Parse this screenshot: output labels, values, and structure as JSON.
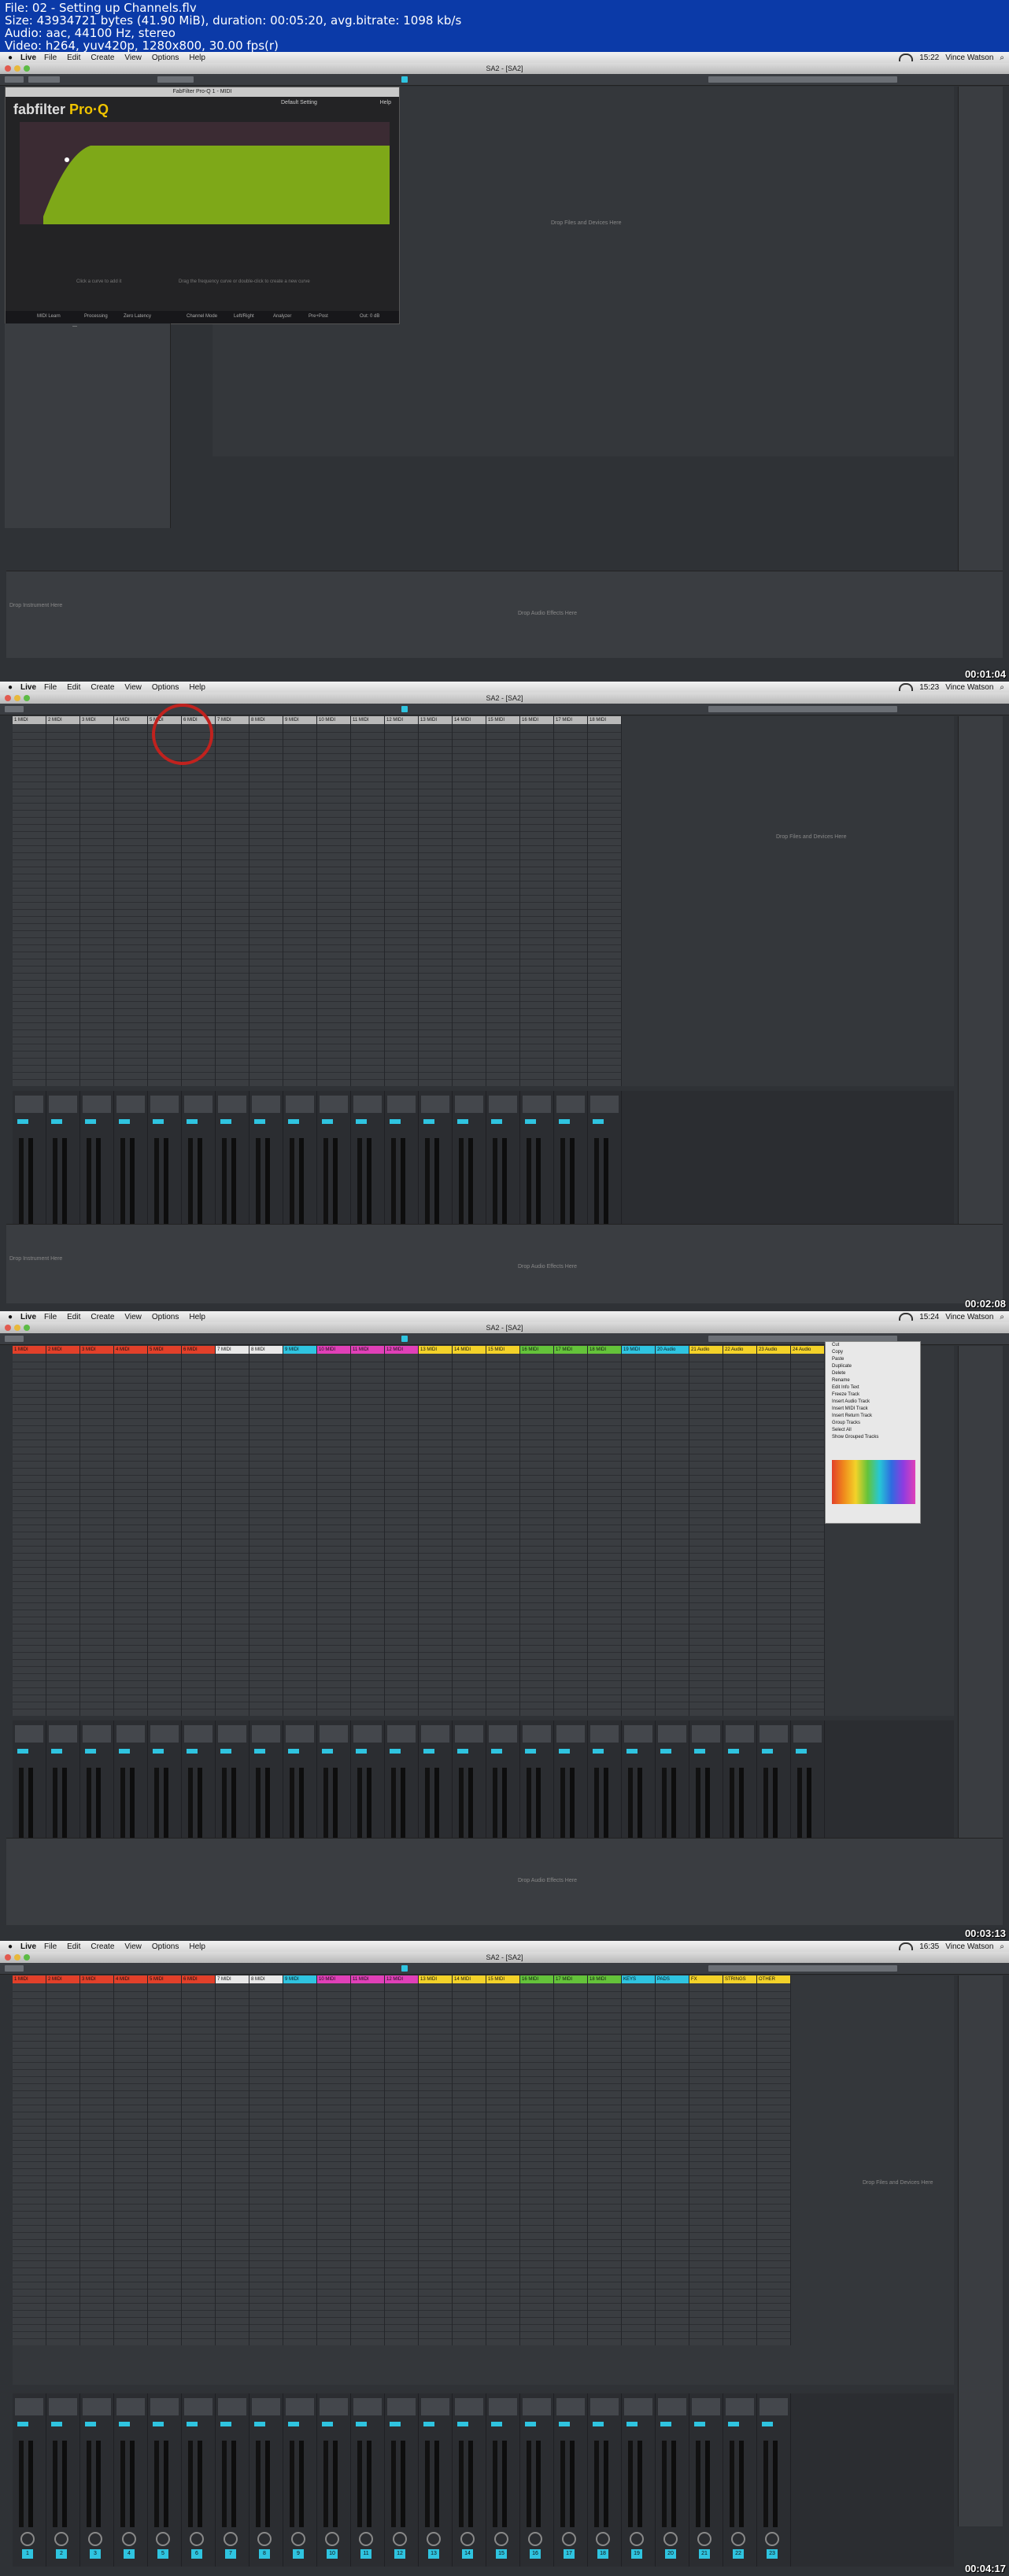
{
  "file_info": [
    "File: 02 - Setting up Channels.flv",
    "Size: 43934721 bytes (41.90 MiB), duration: 00:05:20, avg.bitrate: 1098 kb/s",
    "Audio: aac, 44100 Hz, stereo",
    "Video: h264, yuv420p, 1280x800, 30.00 fps(r)"
  ],
  "menubar": {
    "app": "Live",
    "items": [
      "File",
      "Edit",
      "Create",
      "View",
      "Options",
      "Help"
    ],
    "user": "Vince Watson"
  },
  "window_title": "SA2 - [SA2]",
  "frames": [
    {
      "timestamp": "00:01:04",
      "clock": "15:22"
    },
    {
      "timestamp": "00:02:08",
      "clock": "15:23"
    },
    {
      "timestamp": "00:03:13",
      "clock": "15:24"
    },
    {
      "timestamp": "00:04:17",
      "clock": "16:35"
    }
  ],
  "plugin": {
    "title": "FabFilter Pro-Q 1 - MIDI",
    "brand": "fabfilter",
    "product": "Pro·Q",
    "preset": "Default Setting",
    "help": "Help",
    "footer_items": [
      "MIDI Learn",
      "Processing",
      "Zero Latency",
      "Channel Mode",
      "Left/Right",
      "Analyzer",
      "Pre+Post",
      "Out: 0 dB"
    ],
    "hint_left": "Click a curve to add it",
    "hint_right": "Drag the frequency curve or double-click to create a new curve"
  },
  "hints": {
    "drop_files": "Drop Files and Devices Here",
    "drop_audio": "Drop Audio Effects Here",
    "drop_instrument": "Drop Instrument Here"
  },
  "frame2_tracks": [
    "1 MIDI",
    "2 MIDI",
    "3 MIDI",
    "4 MIDI",
    "5 MIDI",
    "6 MIDI",
    "7 MIDI",
    "8 MIDI",
    "9 MIDI",
    "10 MIDI",
    "11 MIDI",
    "12 MIDI",
    "13 MIDI",
    "14 MIDI",
    "15 MIDI",
    "16 MIDI",
    "17 MIDI",
    "18 MIDI"
  ],
  "frame3_tracks": [
    "1 MIDI",
    "2 MIDI",
    "3 MIDI",
    "4 MIDI",
    "5 MIDI",
    "6 MIDI",
    "7 MIDI",
    "8 MIDI",
    "9 MIDI",
    "10 MIDI",
    "11 MIDI",
    "12 MIDI",
    "13 MIDI",
    "14 MIDI",
    "15 MIDI",
    "16 MIDI",
    "17 MIDI",
    "18 MIDI",
    "19 MIDI",
    "20 Audio",
    "21 Audio",
    "22 Audio",
    "23 Audio",
    "24 Audio"
  ],
  "frame4_tracks": [
    "1 MIDI",
    "2 MIDI",
    "3 MIDI",
    "4 MIDI",
    "5 MIDI",
    "6 MIDI",
    "7 MIDI",
    "8 MIDI",
    "9 MIDI",
    "10 MIDI",
    "11 MIDI",
    "12 MIDI",
    "13 MIDI",
    "14 MIDI",
    "15 MIDI",
    "16 MIDI",
    "17 MIDI",
    "18 MIDI",
    "KEYS",
    "PADS",
    "FX",
    "STRINGS",
    "OTHER"
  ],
  "context_menu": [
    "Cut",
    "Copy",
    "Paste",
    "Duplicate",
    "Delete",
    "Rename",
    "Edit Info Text",
    "Freeze Track",
    "Insert Audio Track",
    "Insert MIDI Track",
    "Insert Return Track",
    "Group Tracks",
    "Select All",
    "Show Grouped Tracks"
  ],
  "colors": {
    "accent_cyan": "#2fc4e0",
    "red": "#e2402a",
    "magenta": "#e040b8",
    "yellow": "#f3d229",
    "green": "#64c33a",
    "blue": "#2f6be0",
    "white": "#e8e8e8"
  }
}
